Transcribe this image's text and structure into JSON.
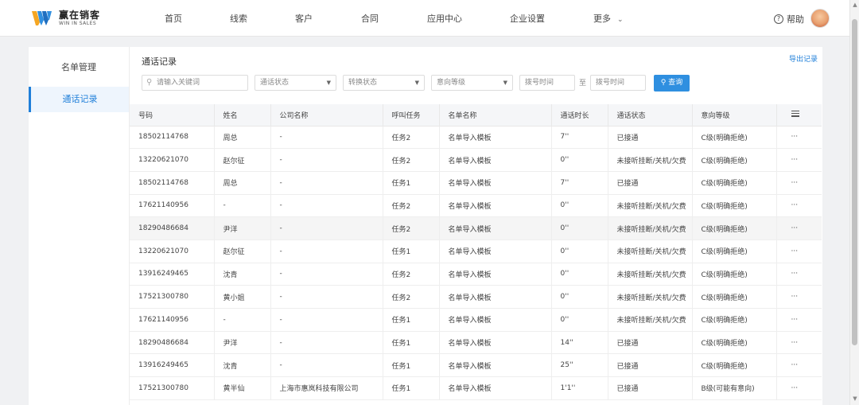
{
  "header": {
    "logo_cn": "赢在销客",
    "logo_en": "WIN IN SALES",
    "nav": [
      "首页",
      "线索",
      "客户",
      "合同",
      "应用中心",
      "企业设置",
      "更多"
    ],
    "help_label": "帮助"
  },
  "sidebar": {
    "items": [
      {
        "label": "名单管理",
        "active": false
      },
      {
        "label": "通话记录",
        "active": true
      }
    ]
  },
  "main": {
    "title": "通话记录",
    "export_label": "导出记录",
    "filters": {
      "search_placeholder": "请输入关键词",
      "call_status": "通话状态",
      "convert_status": "转换状态",
      "intent_level": "意向等级",
      "date_from": "拨号时间",
      "to_label": "至",
      "date_to": "拨号时间",
      "query_label": "查询"
    },
    "table": {
      "headers": [
        "号码",
        "姓名",
        "公司名称",
        "呼叫任务",
        "名单名称",
        "通话时长",
        "通话状态",
        "意向等级"
      ],
      "rows": [
        [
          "18502114768",
          "周总",
          "-",
          "任务2",
          "名单导入模板",
          "7''",
          "已接通",
          "C级(明确拒绝)"
        ],
        [
          "13220621070",
          "赵尔征",
          "-",
          "任务2",
          "名单导入模板",
          "0''",
          "未接听挂断/关机/欠费",
          "C级(明确拒绝)"
        ],
        [
          "18502114768",
          "周总",
          "-",
          "任务1",
          "名单导入模板",
          "7''",
          "已接通",
          "C级(明确拒绝)"
        ],
        [
          "17621140956",
          "-",
          "-",
          "任务2",
          "名单导入模板",
          "0''",
          "未接听挂断/关机/欠费",
          "C级(明确拒绝)"
        ],
        [
          "18290486684",
          "尹洋",
          "-",
          "任务2",
          "名单导入模板",
          "0''",
          "未接听挂断/关机/欠费",
          "C级(明确拒绝)"
        ],
        [
          "13220621070",
          "赵尔征",
          "-",
          "任务1",
          "名单导入模板",
          "0''",
          "未接听挂断/关机/欠费",
          "C级(明确拒绝)"
        ],
        [
          "13916249465",
          "沈青",
          "-",
          "任务2",
          "名单导入模板",
          "0''",
          "未接听挂断/关机/欠费",
          "C级(明确拒绝)"
        ],
        [
          "17521300780",
          "黄小姐",
          "-",
          "任务2",
          "名单导入模板",
          "0''",
          "未接听挂断/关机/欠费",
          "C级(明确拒绝)"
        ],
        [
          "17621140956",
          "-",
          "-",
          "任务1",
          "名单导入模板",
          "0''",
          "未接听挂断/关机/欠费",
          "C级(明确拒绝)"
        ],
        [
          "18290486684",
          "尹洋",
          "-",
          "任务1",
          "名单导入模板",
          "14''",
          "已接通",
          "C级(明确拒绝)"
        ],
        [
          "13916249465",
          "沈青",
          "-",
          "任务1",
          "名单导入模板",
          "25''",
          "已接通",
          "C级(明确拒绝)"
        ],
        [
          "17521300780",
          "黄半仙",
          "上海市惠岚科技有限公司",
          "任务1",
          "名单导入模板",
          "1'1''",
          "已接通",
          "B级(可能有意向)"
        ]
      ],
      "highlighted_row": 4,
      "row_action": "···"
    }
  },
  "colors": {
    "accent": "#1f7fd9",
    "button": "#2f8fe0"
  }
}
